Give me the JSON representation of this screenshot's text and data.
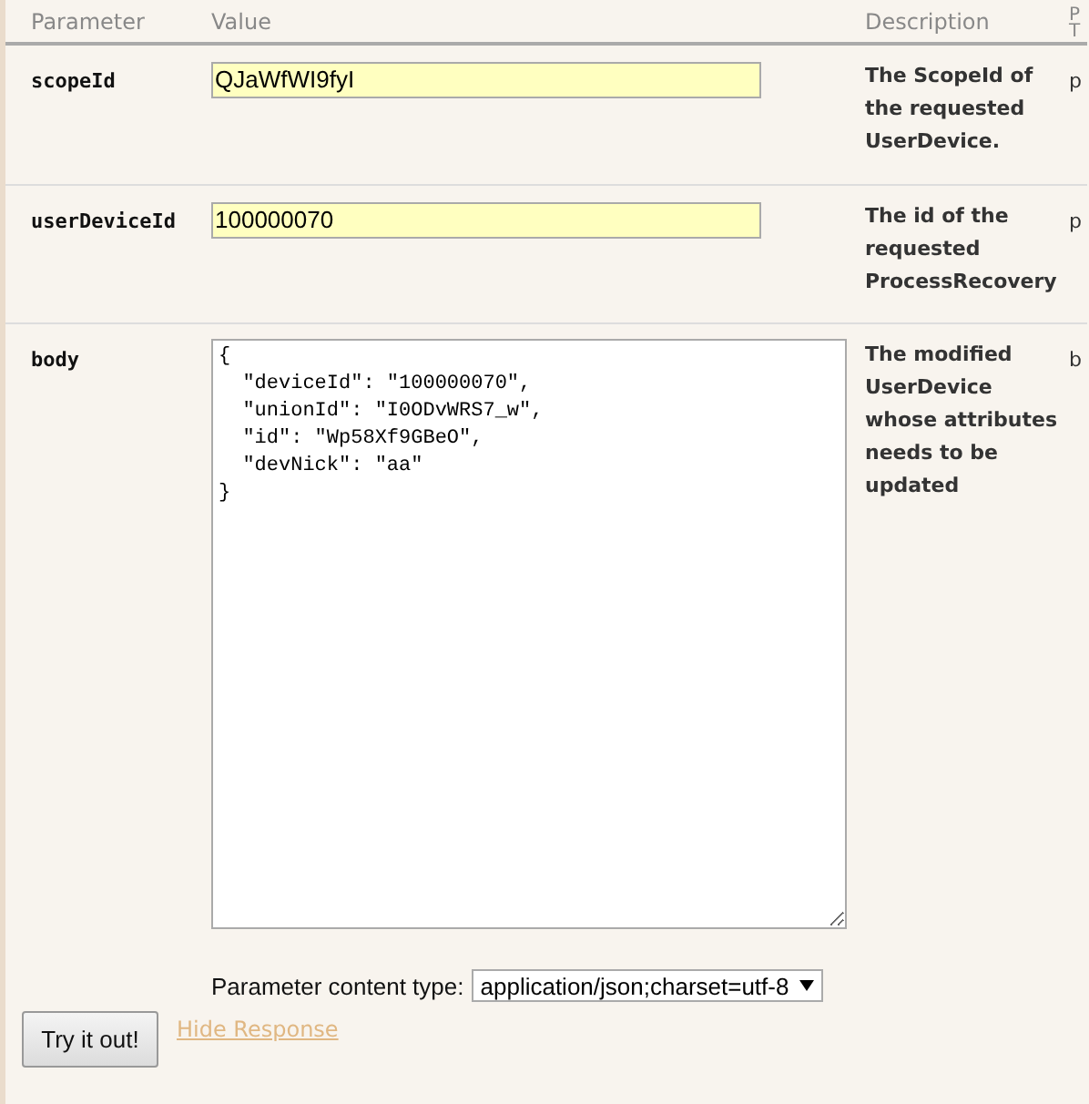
{
  "table": {
    "columns": [
      "Parameter",
      "Value",
      "Description",
      [
        "P",
        "T"
      ]
    ],
    "rows": [
      {
        "name": "scopeId",
        "kind": "text",
        "value": "QJaWfWI9fyI",
        "description": "The ScopeId of the requested UserDevice.",
        "column_4": "p"
      },
      {
        "name": "userDeviceId",
        "kind": "text",
        "value": "100000070",
        "description": "The id of the requested ProcessRecovery",
        "column_4": "p"
      },
      {
        "name": "body",
        "kind": "textarea",
        "value": "{\n  \"deviceId\": \"100000070\",\n  \"unionId\": \"I0ODvWRS7_w\",\n  \"id\": \"Wp58Xf9GBeO\",\n  \"devNick\": \"aa\"\n}",
        "description": "The modified UserDevice whose attributes needs to be updated",
        "column_4": "b"
      }
    ]
  },
  "content_type": {
    "label": "Parameter content type:",
    "value": "application/json;charset=utf-8"
  },
  "try_button": "Try it out!",
  "hide_link": "Hide Response"
}
